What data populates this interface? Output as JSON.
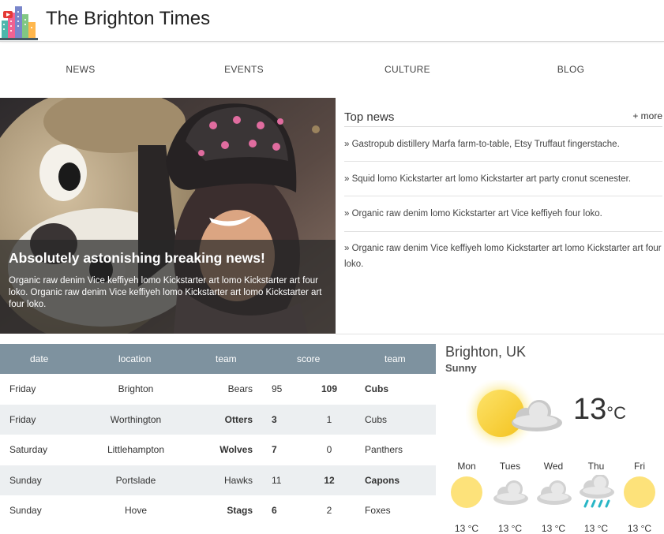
{
  "site": {
    "title": "The Brighton Times",
    "logo_icon": "city-skyline-icon"
  },
  "nav": {
    "items": [
      "NEWS",
      "EVENTS",
      "CULTURE",
      "BLOG"
    ]
  },
  "hero": {
    "headline": "Absolutely astonishing breaking news!",
    "text": "Organic raw denim Vice keffiyeh lomo Kickstarter art lomo Kickstarter art four loko. Organic raw denim Vice keffiyeh lomo Kickstarter art lomo Kickstarter art four loko."
  },
  "top_news": {
    "title": "Top news",
    "more": "+ more",
    "items": [
      "» Gastropub distillery Marfa farm-to-table, Etsy Truffaut fingerstache.",
      "» Squid lomo Kickstarter art lomo Kickstarter art party cronut scenester.",
      "» Organic raw denim lomo Kickstarter art Vice keffiyeh four loko.",
      "» Organic raw denim Vice keffiyeh lomo Kickstarter art lomo Kickstarter art four loko."
    ]
  },
  "scores": {
    "headers": [
      "date",
      "location",
      "team",
      "score",
      "team"
    ],
    "rows": [
      {
        "date": "Friday",
        "location": "Brighton",
        "team1": "Bears",
        "score1": "95",
        "score2": "109",
        "team2": "Cubs",
        "winner": 2
      },
      {
        "date": "Friday",
        "location": "Worthington",
        "team1": "Otters",
        "score1": "3",
        "score2": "1",
        "team2": "Cubs",
        "winner": 1
      },
      {
        "date": "Saturday",
        "location": "Littlehampton",
        "team1": "Wolves",
        "score1": "7",
        "score2": "0",
        "team2": "Panthers",
        "winner": 1
      },
      {
        "date": "Sunday",
        "location": "Portslade",
        "team1": "Hawks",
        "score1": "11",
        "score2": "12",
        "team2": "Capons",
        "winner": 2
      },
      {
        "date": "Sunday",
        "location": "Hove",
        "team1": "Stags",
        "score1": "6",
        "score2": "2",
        "team2": "Foxes",
        "winner": 1
      }
    ]
  },
  "weather": {
    "city": "Brighton, UK",
    "condition": "Sunny",
    "temp": "13",
    "unit": "°C",
    "icon": "partly-cloudy-icon",
    "forecast": [
      {
        "day": "Mon",
        "temp": "13 °C",
        "icon": "sun-icon"
      },
      {
        "day": "Tues",
        "temp": "13 °C",
        "icon": "cloud-icon"
      },
      {
        "day": "Wed",
        "temp": "13 °C",
        "icon": "cloud-icon"
      },
      {
        "day": "Thu",
        "temp": "13 °C",
        "icon": "rain-icon"
      },
      {
        "day": "Fri",
        "temp": "13 °C",
        "icon": "sun-icon"
      }
    ]
  },
  "colors": {
    "table_header": "#7e929f",
    "row_alt": "#eceff1",
    "sun": "#fbd54b"
  }
}
